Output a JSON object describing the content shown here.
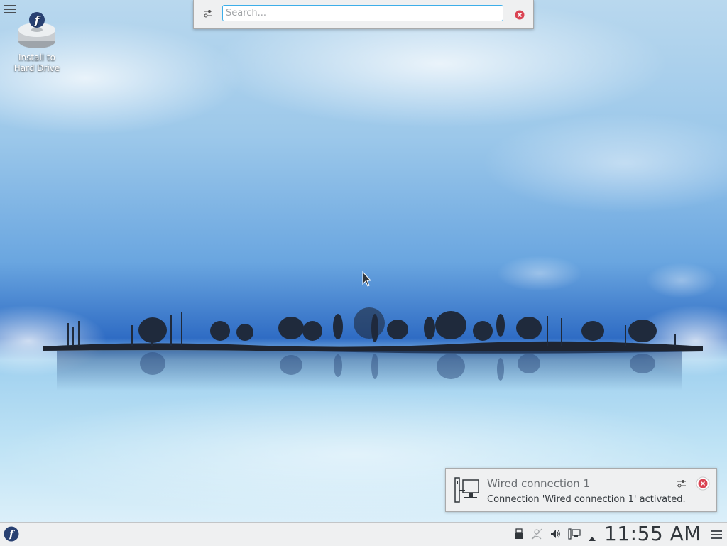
{
  "desktop": {
    "install_icon": {
      "label_line1": "Install to",
      "label_line2": "Hard Drive",
      "icon": "hard-drive-fedora-icon"
    },
    "menu_icon": "hamburger-menu-icon"
  },
  "krunner": {
    "placeholder": "Search...",
    "value": "",
    "config_icon": "configure-icon",
    "close_icon": "close-icon"
  },
  "notification": {
    "title": "Wired connection 1",
    "body": "Connection 'Wired connection 1' activated.",
    "icon": "network-wired-icon"
  },
  "taskbar": {
    "launcher_icon": "fedora-logo-icon",
    "tray_icons": [
      "usb-device-icon",
      "user-switch-icon",
      "volume-icon",
      "network-icon",
      "expand-arrow-icon"
    ],
    "clock": "11:55 AM",
    "menu_icon": "hamburger-menu-icon"
  },
  "colors": {
    "accent": "#3daee9",
    "close_red": "#da4453",
    "panel_bg": "#eff0f1",
    "fedora_blue": "#294172"
  }
}
